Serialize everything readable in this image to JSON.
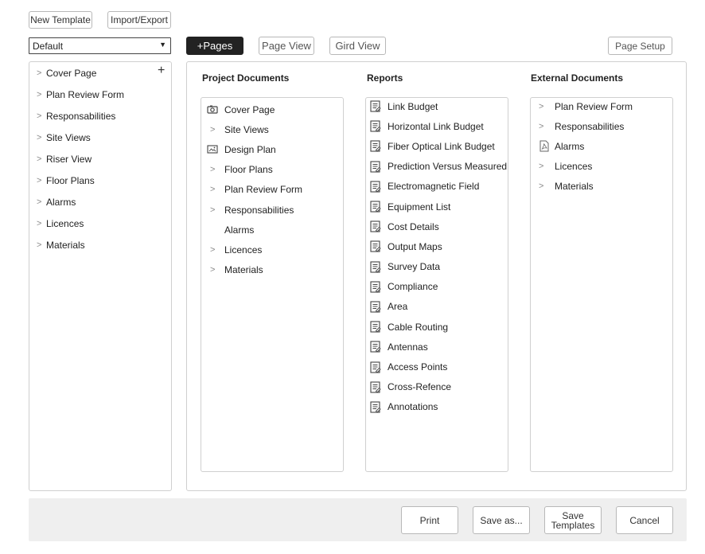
{
  "toolbar": {
    "new_template": "New Template",
    "import_export": "Import/Export"
  },
  "template_select": {
    "value": "Default"
  },
  "view_buttons": {
    "pages": "+Pages",
    "page_view": "Page View",
    "grid_view": "Gird View",
    "page_setup": "Page Setup"
  },
  "sidebar": {
    "items": [
      "Cover Page",
      "Plan Review Form",
      "Responsabilities",
      "Site Views",
      "Riser View",
      "Floor Plans",
      "Alarms",
      "Licences",
      "Materials"
    ]
  },
  "project_documents": {
    "title": "Project Documents",
    "items": [
      {
        "label": "Cover Page",
        "icon": "camera-icon"
      },
      {
        "label": "Site Views",
        "icon": "chevron-right-icon"
      },
      {
        "label": "Design Plan",
        "icon": "image-icon"
      },
      {
        "label": "Floor Plans",
        "icon": "chevron-right-icon"
      },
      {
        "label": "Plan Review Form",
        "icon": "chevron-right-icon"
      },
      {
        "label": "Responsabilities",
        "icon": "chevron-right-icon"
      },
      {
        "label": "Alarms",
        "icon": "none"
      },
      {
        "label": "Licences",
        "icon": "chevron-right-icon"
      },
      {
        "label": "Materials",
        "icon": "chevron-right-icon"
      }
    ]
  },
  "reports": {
    "title": "Reports",
    "items": [
      "Link Budget",
      "Horizontal Link Budget",
      "Fiber Optical Link Budget",
      "Prediction Versus Measured I",
      "Electromagnetic Field",
      "Equipment List",
      "Cost Details",
      "Output Maps",
      "Survey Data",
      "Compliance",
      "Area",
      "Cable Routing",
      "Antennas",
      "Access Points",
      "Cross-Refence",
      "Annotations"
    ]
  },
  "external_documents": {
    "title": "External Documents",
    "items": [
      {
        "label": "Plan Review Form",
        "icon": "chevron-right-icon"
      },
      {
        "label": "Responsabilities",
        "icon": "chevron-right-icon"
      },
      {
        "label": "Alarms",
        "icon": "pdf-icon"
      },
      {
        "label": "Licences",
        "icon": "chevron-right-icon"
      },
      {
        "label": "Materials",
        "icon": "chevron-right-icon"
      }
    ]
  },
  "footer": {
    "print": "Print",
    "save_as": "Save as...",
    "save_templates_line1": "Save",
    "save_templates_line2": "Templates",
    "cancel": "Cancel"
  }
}
